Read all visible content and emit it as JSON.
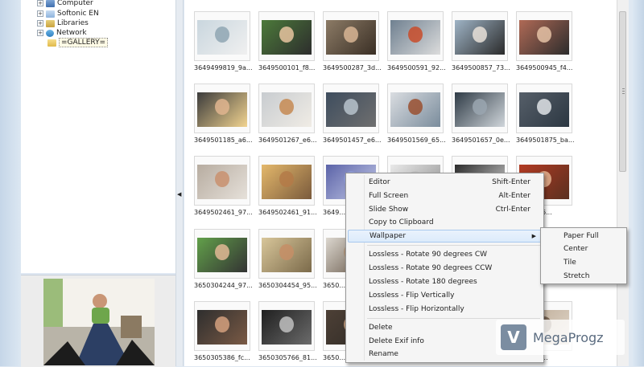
{
  "tree": {
    "items": [
      {
        "label": "Computer",
        "icon": "computer-icon"
      },
      {
        "label": "Softonic EN",
        "icon": "drive-icon"
      },
      {
        "label": "Libraries",
        "icon": "libraries-icon"
      },
      {
        "label": "Network",
        "icon": "network-icon"
      },
      {
        "label": "=GALLERY=",
        "icon": "folder-icon"
      }
    ],
    "expand_glyph": "+"
  },
  "thumbnails": [
    {
      "caption": "3649499819_9a..."
    },
    {
      "caption": "3649500101_f8..."
    },
    {
      "caption": "3649500287_3d..."
    },
    {
      "caption": "3649500591_92..."
    },
    {
      "caption": "3649500857_73..."
    },
    {
      "caption": "3649500945_f4..."
    },
    {
      "caption": "3649501185_a6..."
    },
    {
      "caption": "3649501267_e6..."
    },
    {
      "caption": "3649501457_e6..."
    },
    {
      "caption": "3649501569_65..."
    },
    {
      "caption": "3649501657_0e..."
    },
    {
      "caption": "3649501875_ba..."
    },
    {
      "caption": "3649502461_97..."
    },
    {
      "caption": "3649502461_91..."
    },
    {
      "caption": "3649..."
    },
    {
      "caption": ""
    },
    {
      "caption": ""
    },
    {
      "caption": "...094_06..."
    },
    {
      "caption": "3650304244_97..."
    },
    {
      "caption": "3650304454_95..."
    },
    {
      "caption": "3650..."
    },
    {
      "caption": ""
    },
    {
      "caption": ""
    },
    {
      "caption": ""
    },
    {
      "caption": "3650305386_fc..."
    },
    {
      "caption": "3650305766_81..."
    },
    {
      "caption": "3650..."
    },
    {
      "caption": ""
    },
    {
      "caption": ""
    },
    {
      "caption": "...3666_..."
    }
  ],
  "context_menu": {
    "items": [
      {
        "label": "Editor",
        "shortcut": "Shift-Enter"
      },
      {
        "label": "Full Screen",
        "shortcut": "Alt-Enter"
      },
      {
        "label": "Slide Show",
        "shortcut": "Ctrl-Enter"
      },
      {
        "label": "Copy to Clipboard",
        "shortcut": ""
      },
      {
        "label": "Wallpaper",
        "shortcut": "",
        "submenu_arrow": "▶"
      },
      {
        "label": "Lossless - Rotate 90 degrees CW",
        "shortcut": ""
      },
      {
        "label": "Lossless - Rotate 90 degrees CCW",
        "shortcut": ""
      },
      {
        "label": "Lossless - Rotate 180 degrees",
        "shortcut": ""
      },
      {
        "label": "Lossless - Flip Vertically",
        "shortcut": ""
      },
      {
        "label": "Lossless - Flip Horizontally",
        "shortcut": ""
      },
      {
        "label": "Delete",
        "shortcut": ""
      },
      {
        "label": "Delete Exif info",
        "shortcut": ""
      },
      {
        "label": "Rename",
        "shortcut": ""
      }
    ],
    "highlighted": "Wallpaper"
  },
  "wallpaper_submenu": {
    "items": [
      {
        "label": "Paper Full"
      },
      {
        "label": "Center"
      },
      {
        "label": "Tile"
      },
      {
        "label": "Stretch"
      }
    ]
  },
  "watermark": {
    "text": "MegaProgz",
    "icon_glyph": "V"
  },
  "splitter": {
    "arrow": "◀"
  }
}
